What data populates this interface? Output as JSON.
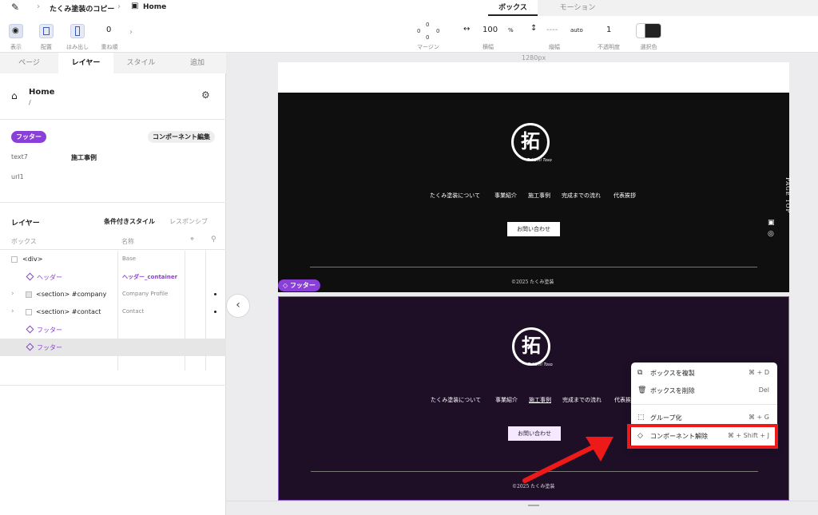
{
  "breadcrumb": {
    "project": "たくみ塗装のコピー",
    "page": "Home"
  },
  "mode_tabs": {
    "box": "ボックス",
    "motion": "モーション"
  },
  "toolbar": {
    "view": "表示",
    "layout": "配置",
    "overflow": "はみ出し",
    "zindex_label": "重ね順",
    "zindex_value": "0",
    "margin_label": "マージン",
    "margin_top": "0",
    "margin_left": "0",
    "margin_right": "0",
    "margin_bottom": "0",
    "width_value": "100",
    "width_unit": "%",
    "width_label": "横幅",
    "height_value": "----",
    "height_unit": "auto",
    "height_label": "縦幅",
    "opacity_value": "1",
    "opacity_label": "不透明度",
    "select_color_label": "選択色"
  },
  "sidebar": {
    "tabs": [
      "ページ",
      "レイヤー",
      "スタイル",
      "追加"
    ],
    "active_tab": "レイヤー",
    "page_name": "Home",
    "page_path": "/",
    "component_badge": "フッター",
    "edit_component": "コンポーネント編集",
    "fields": [
      {
        "label": "text7",
        "value": "施工事例"
      },
      {
        "label": "url1",
        "value": ""
      }
    ],
    "layer_title": "レイヤー",
    "conditional_style": "条件付きスタイル",
    "responsive": "レスポンシブ",
    "col_box": "ボックス",
    "col_name": "名称",
    "layers": [
      {
        "name": "<div>",
        "comp": "Base"
      },
      {
        "name": "ヘッダー",
        "comp": "ヘッダー_container"
      },
      {
        "name": "<section> #company",
        "comp": "Company Profile"
      },
      {
        "name": "<section> #contact",
        "comp": "Contact"
      },
      {
        "name": "フッター",
        "comp": ""
      },
      {
        "name": "フッター",
        "comp": ""
      }
    ]
  },
  "canvas": {
    "width_label": "1280px",
    "footer_badge": "フッター",
    "logo_char": "拓",
    "logo_sub": "Takumi Toso",
    "nav": [
      "たくみ塗装について",
      "事業紹介",
      "施工事例",
      "完成までの流れ",
      "代表挨拶"
    ],
    "contact_button": "お問い合わせ",
    "copyright": "©2025 たくみ塗装",
    "page_top": "PAGE TOP"
  },
  "context_menu": {
    "items": [
      {
        "label": "ボックスを複製",
        "shortcut": "⌘ + D"
      },
      {
        "label": "ボックスを削除",
        "shortcut": "Del"
      },
      {
        "label": "グループ化",
        "shortcut": "⌘ + G"
      },
      {
        "label": "コンポーネント解除",
        "shortcut": "⌘ + Shift + J"
      }
    ]
  },
  "colors": {
    "accent": "#8b3fd9",
    "highlight": "#ee1a1a",
    "footer_dark": "#0f0f0f",
    "footer_purple": "#1e0f27"
  }
}
